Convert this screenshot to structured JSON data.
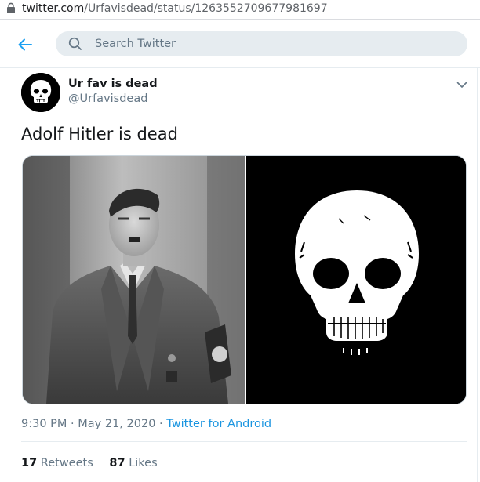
{
  "browser": {
    "url_domain": "twitter.com",
    "url_path": "/Urfavisdead/status/1263552709677981697"
  },
  "header": {
    "search_placeholder": "Search Twitter"
  },
  "tweet": {
    "display_name": "Ur fav is dead",
    "handle": "@Urfavisdead",
    "text": "Adolf Hitler is dead",
    "time": "9:30 PM",
    "date": "May 21, 2020",
    "source": "Twitter for Android",
    "retweets_count": "17",
    "retweets_label": "Retweets",
    "likes_count": "87",
    "likes_label": "Likes"
  },
  "colors": {
    "accent": "#1da1f2",
    "search_bg": "#e6ecf0",
    "secondary_text": "#657786"
  },
  "icons": [
    "lock-icon",
    "back-arrow-icon",
    "search-icon",
    "chevron-down-icon",
    "skull-icon"
  ]
}
